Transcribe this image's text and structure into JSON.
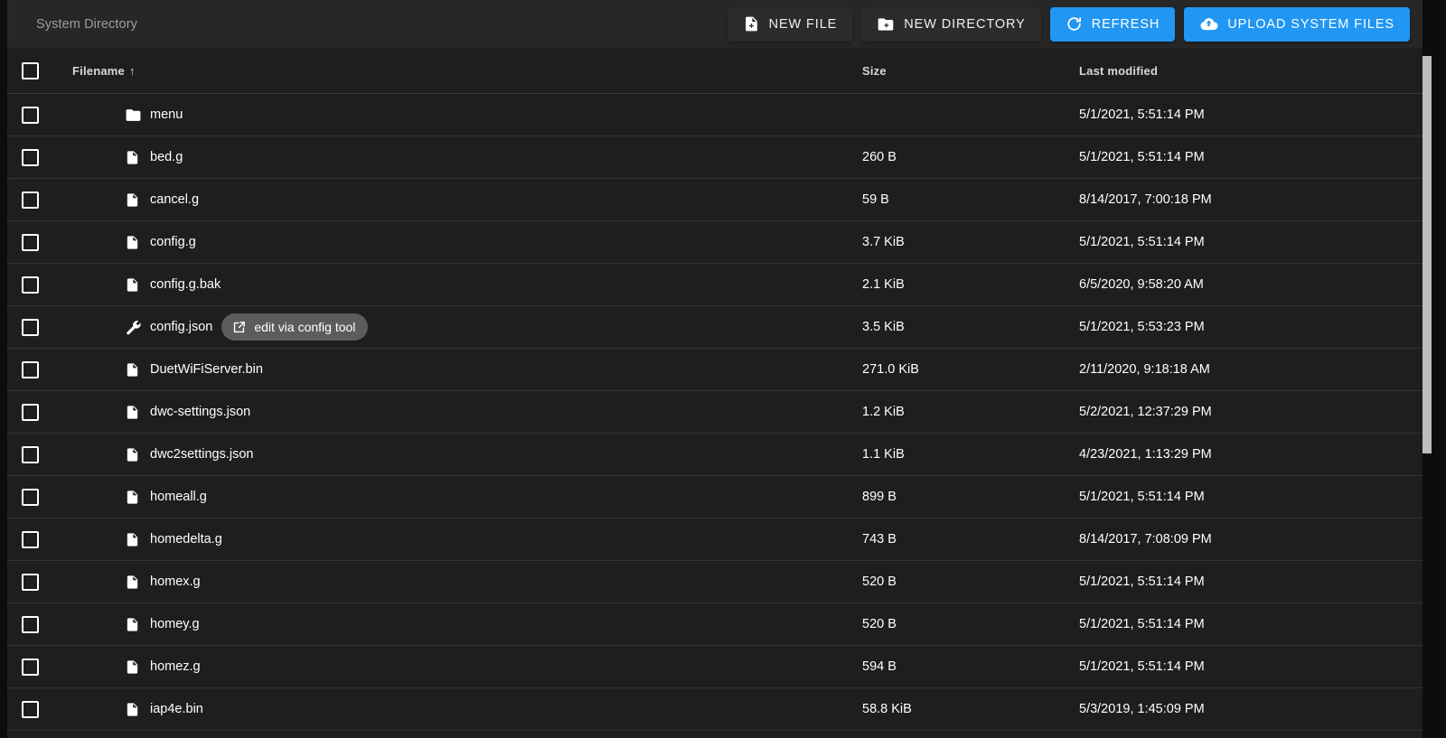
{
  "toolbar": {
    "title": "System Directory",
    "buttons": [
      {
        "label": "NEW FILE",
        "icon": "file-plus-icon",
        "style": "dark"
      },
      {
        "label": "NEW DIRECTORY",
        "icon": "folder-plus-icon",
        "style": "dark"
      },
      {
        "label": "REFRESH",
        "icon": "refresh-icon",
        "style": "primary"
      },
      {
        "label": "UPLOAD SYSTEM FILES",
        "icon": "cloud-upload-icon",
        "style": "primary"
      }
    ]
  },
  "colors": {
    "accent": "#2196f3",
    "toolbar_bg": "#272727",
    "table_bg": "#1e1e1e",
    "page_bg": "#0d0d0d",
    "chip_bg": "#5c5c5c",
    "scrollbar_thumb": "#bdbdbd"
  },
  "table": {
    "columns": [
      {
        "key": "filename",
        "label": "Filename",
        "sorted": true,
        "sort_direction": "ascending",
        "sort_arrow": "↑"
      },
      {
        "key": "size",
        "label": "Size"
      },
      {
        "key": "modified",
        "label": "Last modified"
      }
    ],
    "select_all_checkbox": {
      "checked": false
    },
    "rows": [
      {
        "name": "menu",
        "icon": "folder-icon",
        "size": "",
        "modified": "5/1/2021, 5:51:14 PM",
        "checked": false
      },
      {
        "name": "bed.g",
        "icon": "file-icon",
        "size": "260 B",
        "modified": "5/1/2021, 5:51:14 PM",
        "checked": false
      },
      {
        "name": "cancel.g",
        "icon": "file-icon",
        "size": "59 B",
        "modified": "8/14/2017, 7:00:18 PM",
        "checked": false
      },
      {
        "name": "config.g",
        "icon": "file-icon",
        "size": "3.7 KiB",
        "modified": "5/1/2021, 5:51:14 PM",
        "checked": false
      },
      {
        "name": "config.g.bak",
        "icon": "file-icon",
        "size": "2.1 KiB",
        "modified": "6/5/2020, 9:58:20 AM",
        "checked": false
      },
      {
        "name": "config.json",
        "icon": "wrench-icon",
        "size": "3.5 KiB",
        "modified": "5/1/2021, 5:53:23 PM",
        "checked": false,
        "chip": {
          "label": "edit via config tool",
          "icon": "open-in-new-icon"
        }
      },
      {
        "name": "DuetWiFiServer.bin",
        "icon": "file-icon",
        "size": "271.0 KiB",
        "modified": "2/11/2020, 9:18:18 AM",
        "checked": false
      },
      {
        "name": "dwc-settings.json",
        "icon": "file-icon",
        "size": "1.2 KiB",
        "modified": "5/2/2021, 12:37:29 PM",
        "checked": false
      },
      {
        "name": "dwc2settings.json",
        "icon": "file-icon",
        "size": "1.1 KiB",
        "modified": "4/23/2021, 1:13:29 PM",
        "checked": false
      },
      {
        "name": "homeall.g",
        "icon": "file-icon",
        "size": "899 B",
        "modified": "5/1/2021, 5:51:14 PM",
        "checked": false
      },
      {
        "name": "homedelta.g",
        "icon": "file-icon",
        "size": "743 B",
        "modified": "8/14/2017, 7:08:09 PM",
        "checked": false
      },
      {
        "name": "homex.g",
        "icon": "file-icon",
        "size": "520 B",
        "modified": "5/1/2021, 5:51:14 PM",
        "checked": false
      },
      {
        "name": "homey.g",
        "icon": "file-icon",
        "size": "520 B",
        "modified": "5/1/2021, 5:51:14 PM",
        "checked": false
      },
      {
        "name": "homez.g",
        "icon": "file-icon",
        "size": "594 B",
        "modified": "5/1/2021, 5:51:14 PM",
        "checked": false
      },
      {
        "name": "iap4e.bin",
        "icon": "file-icon",
        "size": "58.8 KiB",
        "modified": "5/3/2019, 1:45:09 PM",
        "checked": false
      }
    ]
  },
  "scrollbar": {
    "visible": true
  }
}
